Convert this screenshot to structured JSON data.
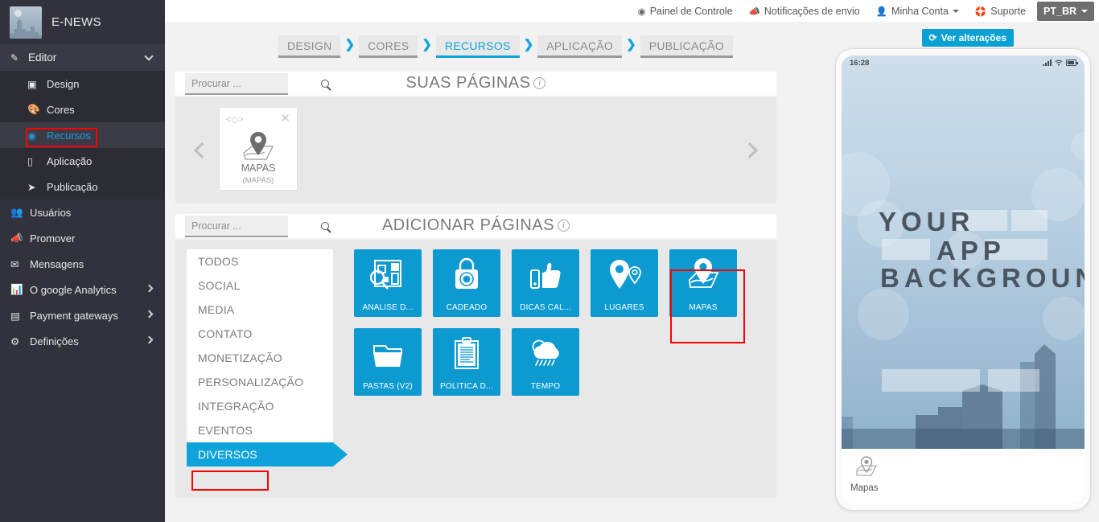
{
  "brand": {
    "title": "E-NEWS",
    "logo_icon": "city-thumbnail"
  },
  "sidebar": {
    "group": {
      "label": "Editor",
      "icon": "pencil-icon",
      "chevron": "chevron-down-icon"
    },
    "sub_items": [
      {
        "label": "Design",
        "icon": "design-icon",
        "active": false
      },
      {
        "label": "Cores",
        "icon": "palette-icon",
        "active": false
      },
      {
        "label": "Recursos",
        "icon": "cube-icon",
        "active": true
      },
      {
        "label": "Aplicação",
        "icon": "mobile-icon",
        "active": false
      },
      {
        "label": "Publicação",
        "icon": "paper-plane-icon",
        "active": false
      }
    ],
    "main_items": [
      {
        "label": "Usuários",
        "icon": "users-icon",
        "caret": false
      },
      {
        "label": "Promover",
        "icon": "megaphone-icon",
        "caret": false
      },
      {
        "label": "Mensagens",
        "icon": "envelope-icon",
        "caret": false
      },
      {
        "label": "O google Analytics",
        "icon": "bar-chart-icon",
        "caret": true
      },
      {
        "label": "Payment gateways",
        "icon": "credit-card-icon",
        "caret": true
      },
      {
        "label": "Definições",
        "icon": "gears-icon",
        "caret": true
      }
    ]
  },
  "topbar": {
    "items": [
      {
        "label": "Painel de Controle",
        "icon": "dashboard-icon",
        "caret": false
      },
      {
        "label": "Notificações de envio",
        "icon": "bullhorn-icon",
        "caret": false
      },
      {
        "label": "Minha Conta",
        "icon": "user-icon",
        "caret": true
      },
      {
        "label": "Suporte",
        "icon": "lifebuoy-icon",
        "caret": false
      }
    ],
    "language": "PT_BR"
  },
  "actions": {
    "view_changes": "Ver alterações",
    "view_changes_icon": "refresh-icon"
  },
  "breadcrumb": {
    "separator": "❯",
    "items": [
      {
        "label": "DESIGN",
        "active": false
      },
      {
        "label": "CORES",
        "active": false
      },
      {
        "label": "RECURSOS",
        "active": true
      },
      {
        "label": "APLICAÇÃO",
        "active": false
      },
      {
        "label": "PUBLICAÇÃO",
        "active": false
      }
    ]
  },
  "your_pages": {
    "title": "SUAS PÁGINAS",
    "search_placeholder": "Procurar ...",
    "search_value": "",
    "info_icon": "info-icon",
    "cards": [
      {
        "name": "MAPAS",
        "sub": "(MAPAS)",
        "icon": "map-pin-icon",
        "code_icon": "code-icon",
        "close_icon": "close-icon"
      }
    ],
    "prev_icon": "chevron-left-icon",
    "next_icon": "chevron-right-icon"
  },
  "add_pages": {
    "title": "ADICIONAR PÁGINAS",
    "search_placeholder": "Procurar ...",
    "search_value": "",
    "info_icon": "info-icon",
    "categories": [
      {
        "label": "TODOS",
        "active": false
      },
      {
        "label": "SOCIAL",
        "active": false
      },
      {
        "label": "MEDIA",
        "active": false
      },
      {
        "label": "CONTATO",
        "active": false
      },
      {
        "label": "MONETIZAÇÃO",
        "active": false
      },
      {
        "label": "PERSONALIZAÇÃO",
        "active": false
      },
      {
        "label": "INTEGRAÇÃO",
        "active": false
      },
      {
        "label": "EVENTOS",
        "active": false
      },
      {
        "label": "DIVERSOS",
        "active": true
      }
    ],
    "tiles": [
      [
        {
          "label": "ANÁLISE D...",
          "icon": "analytics-icon",
          "highlighted": false
        },
        {
          "label": "CADEADO",
          "icon": "padlock-icon",
          "highlighted": false
        },
        {
          "label": "DICAS CAL...",
          "icon": "thumbs-up-icon",
          "highlighted": false
        },
        {
          "label": "LUGARES",
          "icon": "places-pin-icon",
          "highlighted": false
        },
        {
          "label": "MAPAS",
          "icon": "map-pin-icon",
          "highlighted": true
        }
      ],
      [
        {
          "label": "PASTAS (V2)",
          "icon": "folder-icon",
          "highlighted": false
        },
        {
          "label": "POLÍTICA D...",
          "icon": "clipboard-icon",
          "highlighted": false
        },
        {
          "label": "TEMPO",
          "icon": "weather-rain-icon",
          "highlighted": false
        }
      ]
    ]
  },
  "preview": {
    "status_time": "16:28",
    "signal_icon": "signal-bars-icon",
    "wifi_icon": "wifi-icon",
    "battery_icon": "battery-icon",
    "background_text_lines": [
      "YOUR",
      "APP",
      "BACKGROUND"
    ],
    "footer_item": {
      "label": "Mapas",
      "icon": "map-pin-icon"
    }
  },
  "colors": {
    "accent": "#0fa3dc",
    "tile": "#0c9ad1",
    "sidebar": "#32323c",
    "sidebar_sub": "#2c2c35",
    "highlight": "#fe0000",
    "panel_body": "#e8e8e8"
  }
}
